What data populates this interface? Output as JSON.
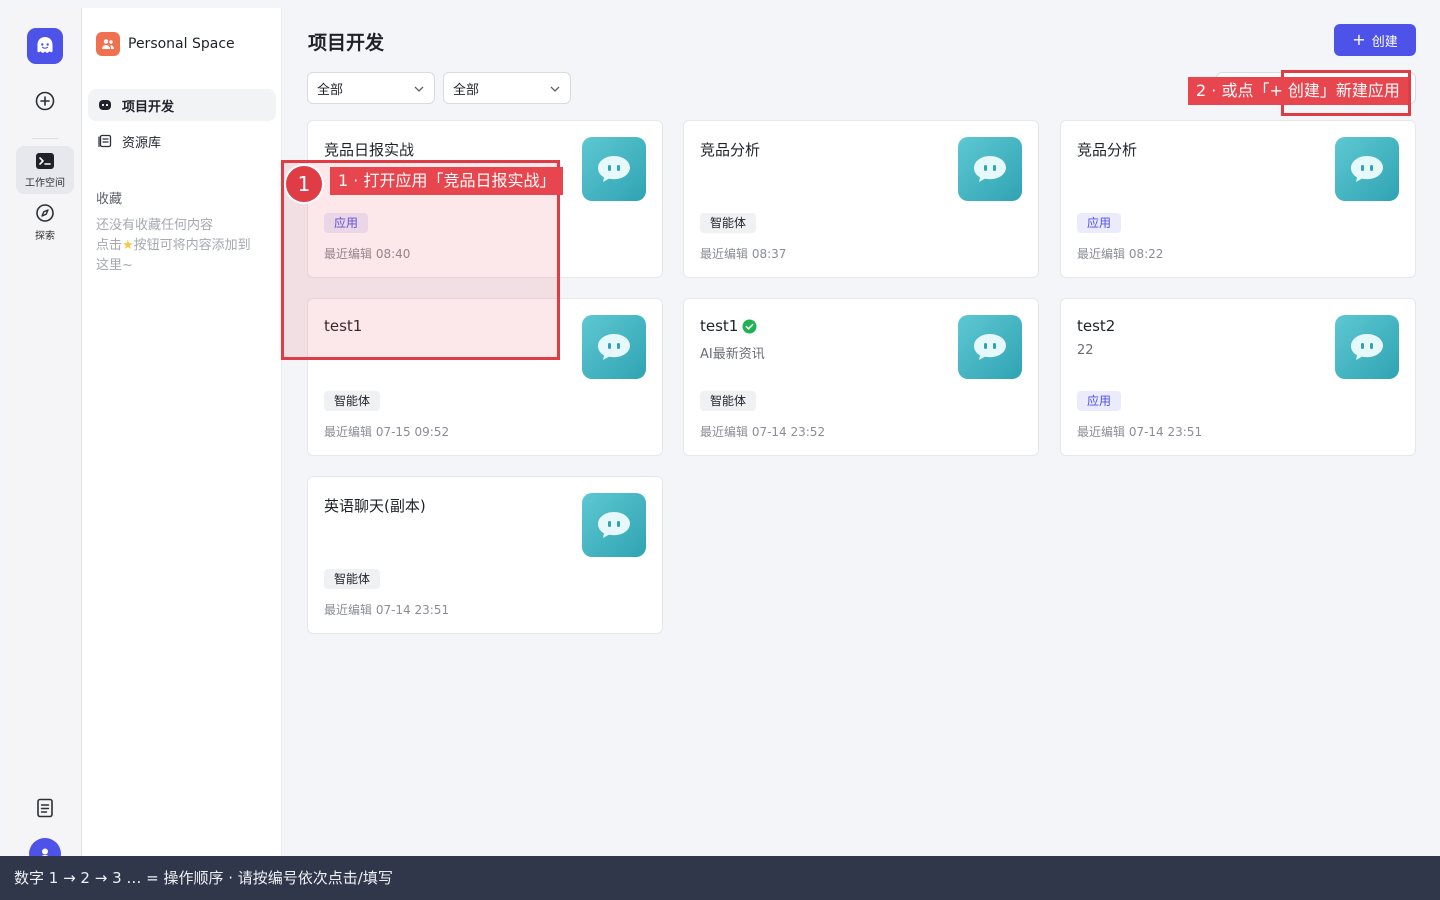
{
  "rail": {
    "workspace_label": "工作空间",
    "explore_label": "探索"
  },
  "sidebar": {
    "space_name": "Personal Space",
    "items": [
      {
        "label": "项目开发"
      },
      {
        "label": "资源库"
      }
    ],
    "favorites_title": "收藏",
    "favorites_empty_line1": "还没有收藏任何内容",
    "favorites_empty_line2_a": "点击",
    "favorites_empty_line2_b": "按钮可将内容添加到",
    "favorites_empty_line3": "这里~"
  },
  "main": {
    "title": "项目开发",
    "create_label": "创建",
    "filters": [
      {
        "value": "全部"
      },
      {
        "value": "全部"
      }
    ],
    "cards": [
      {
        "name": "竞品日报实战",
        "desc": "",
        "tag": "应用",
        "tag_type": "app",
        "time": "最近编辑 08:40"
      },
      {
        "name": "竞品分析",
        "desc": "",
        "tag": "智能体",
        "tag_type": "agent",
        "time": "最近编辑 08:37"
      },
      {
        "name": "竞品分析",
        "desc": "",
        "tag": "应用",
        "tag_type": "app",
        "time": "最近编辑 08:22"
      },
      {
        "name": "test1",
        "desc": "",
        "tag": "智能体",
        "tag_type": "agent",
        "time": "最近编辑 07-15 09:52"
      },
      {
        "name": "test1",
        "desc": "AI最新资讯",
        "tag": "智能体",
        "tag_type": "agent",
        "time": "最近编辑 07-14 23:52",
        "verified": true
      },
      {
        "name": "test2",
        "desc": "22",
        "tag": "应用",
        "tag_type": "app",
        "time": "最近编辑 07-14 23:51"
      },
      {
        "name": "英语聊天(副本)",
        "desc": "",
        "tag": "智能体",
        "tag_type": "agent",
        "time": "最近编辑 07-14 23:51"
      }
    ]
  },
  "annotations": {
    "step1_number": "1",
    "step1_label": "1 ·  打开应用「竞品日报实战」",
    "step2_label": "2 ·  或点「+ 创建」新建应用"
  },
  "footer": {
    "hint": "数字 1 → 2 → 3 … = 操作顺序 ·  请按编号依次点击/填写"
  },
  "colors": {
    "brand": "#4d53e8",
    "annotation": "#e03c45",
    "footer_bg": "#31374a"
  }
}
